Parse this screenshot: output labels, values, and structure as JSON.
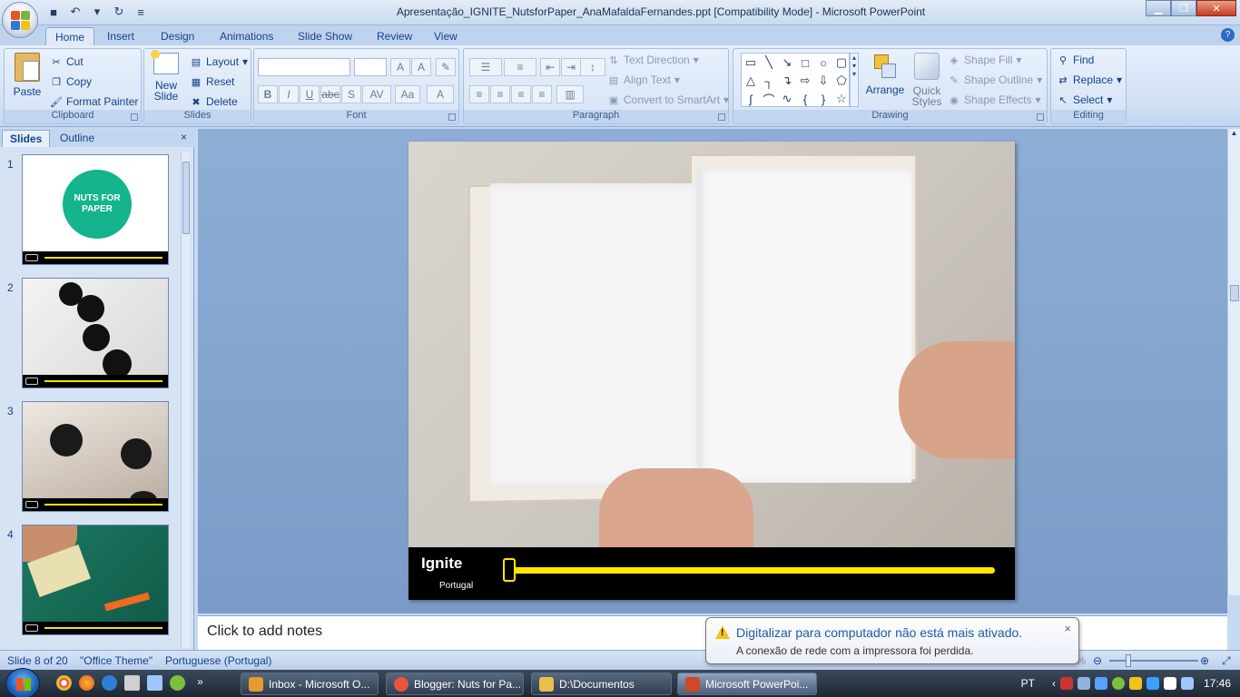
{
  "window": {
    "title": "Apresentação_IGNITE_NutsforPaper_AnaMafaldaFernandes.ppt [Compatibility Mode] - Microsoft PowerPoint"
  },
  "ribbon_tabs": [
    "Home",
    "Insert",
    "Design",
    "Animations",
    "Slide Show",
    "Review",
    "View"
  ],
  "clipboard": {
    "paste": "Paste",
    "cut": "Cut",
    "copy": "Copy",
    "format_painter": "Format Painter",
    "label": "Clipboard"
  },
  "slides_group": {
    "new_slide": "New",
    "new_slide2": "Slide",
    "layout": "Layout",
    "reset": "Reset",
    "delete": "Delete",
    "label": "Slides"
  },
  "font_group": {
    "label": "Font"
  },
  "paragraph_group": {
    "text_direction": "Text Direction",
    "align_text": "Align Text",
    "convert_smartart": "Convert to SmartArt",
    "label": "Paragraph"
  },
  "drawing_group": {
    "arrange": "Arrange",
    "quick_styles": "Quick",
    "quick_styles2": "Styles",
    "shape_fill": "Shape Fill",
    "shape_outline": "Shape Outline",
    "shape_effects": "Shape Effects",
    "label": "Drawing"
  },
  "editing_group": {
    "find": "Find",
    "replace": "Replace",
    "select": "Select",
    "label": "Editing"
  },
  "panel": {
    "tab_slides": "Slides",
    "tab_outline": "Outline",
    "close": "×",
    "thumbs": [
      {
        "num": "1",
        "caption": "NUTS FOR PAPER"
      },
      {
        "num": "2",
        "caption": ""
      },
      {
        "num": "3",
        "caption": ""
      },
      {
        "num": "4",
        "caption": ""
      }
    ]
  },
  "slide": {
    "logo": "Ignite",
    "logo_sub": "Portugal",
    "progress": 0
  },
  "notes": {
    "placeholder": "Click to add notes"
  },
  "status": {
    "slide": "Slide 8 of 20",
    "theme": "\"Office Theme\"",
    "language": "Portuguese (Portugal)",
    "zoom": "49%"
  },
  "balloon": {
    "title": "Digitalizar para computador não está mais ativado.",
    "text": "A conexão de rede com a impressora foi perdida.",
    "close": "×"
  },
  "taskbar": {
    "items": [
      {
        "label": "Inbox - Microsoft O...",
        "color": "#e59a2c"
      },
      {
        "label": "Blogger: Nuts for Pa...",
        "color": "#e8553c"
      },
      {
        "label": "D:\\Documentos",
        "color": "#e8c04a"
      },
      {
        "label": "Microsoft PowerPoi...",
        "color": "#d24726"
      }
    ],
    "lang": "PT",
    "time": "17:46"
  },
  "colors": {
    "accent_yellow": "#ffe600",
    "ribbon_blue": "#15428b"
  }
}
